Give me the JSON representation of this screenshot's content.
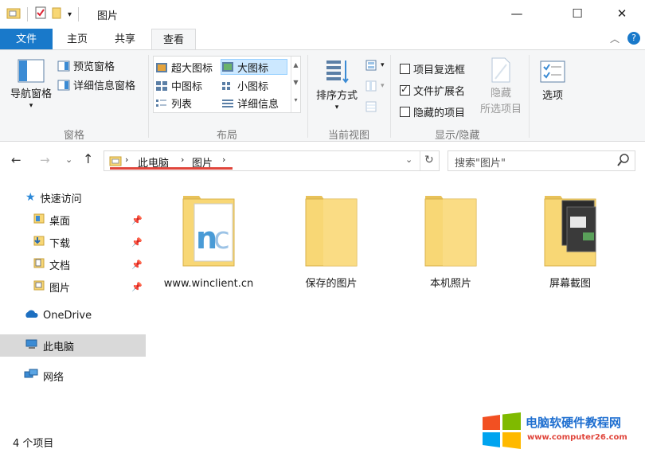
{
  "window": {
    "title": "图片",
    "minimize_icon": "—",
    "maximize_icon": "☐",
    "close_icon": "✕"
  },
  "tabs": [
    {
      "label": "文件"
    },
    {
      "label": "主页"
    },
    {
      "label": "共享"
    },
    {
      "label": "查看"
    }
  ],
  "ribbon": {
    "panes": {
      "nav_pane": "导航窗格",
      "preview_pane": "预览窗格",
      "details_pane": "详细信息窗格",
      "group_label": "窗格"
    },
    "layout": {
      "extra_large": "超大图标",
      "large": "大图标",
      "medium": "中图标",
      "small": "小图标",
      "list": "列表",
      "details": "详细信息",
      "group_label": "布局"
    },
    "current_view": {
      "sort_by": "排序方式",
      "group_label": "当前视图"
    },
    "show_hide": {
      "item_checkboxes": "项目复选框",
      "item_checkboxes_checked": false,
      "file_extensions": "文件扩展名",
      "file_extensions_checked": true,
      "hidden_items": "隐藏的项目",
      "hidden_items_checked": false,
      "hide_selected_1": "隐藏",
      "hide_selected_2": "所选项目",
      "group_label": "显示/隐藏"
    },
    "options": "选项"
  },
  "address": {
    "crumbs": [
      "此电脑",
      "图片"
    ],
    "search_placeholder": "搜索\"图片\""
  },
  "nav": {
    "quick_access": "快速访问",
    "items": [
      {
        "label": "桌面"
      },
      {
        "label": "下载"
      },
      {
        "label": "文档"
      },
      {
        "label": "图片"
      }
    ],
    "onedrive": "OneDrive",
    "this_pc": "此电脑",
    "network": "网络"
  },
  "files": [
    {
      "name": "www.winclient.cn"
    },
    {
      "name": "保存的图片"
    },
    {
      "name": "本机照片"
    },
    {
      "name": "屏幕截图"
    }
  ],
  "status": {
    "count": "4 个项目"
  },
  "watermark": {
    "line1": "电脑软硬件教程网",
    "line2": "www.computer26.com"
  },
  "colors": {
    "accent": "#1979ca",
    "folder": "#f8d775",
    "highlight": "#cce8ff",
    "underline": "#e0463c"
  }
}
